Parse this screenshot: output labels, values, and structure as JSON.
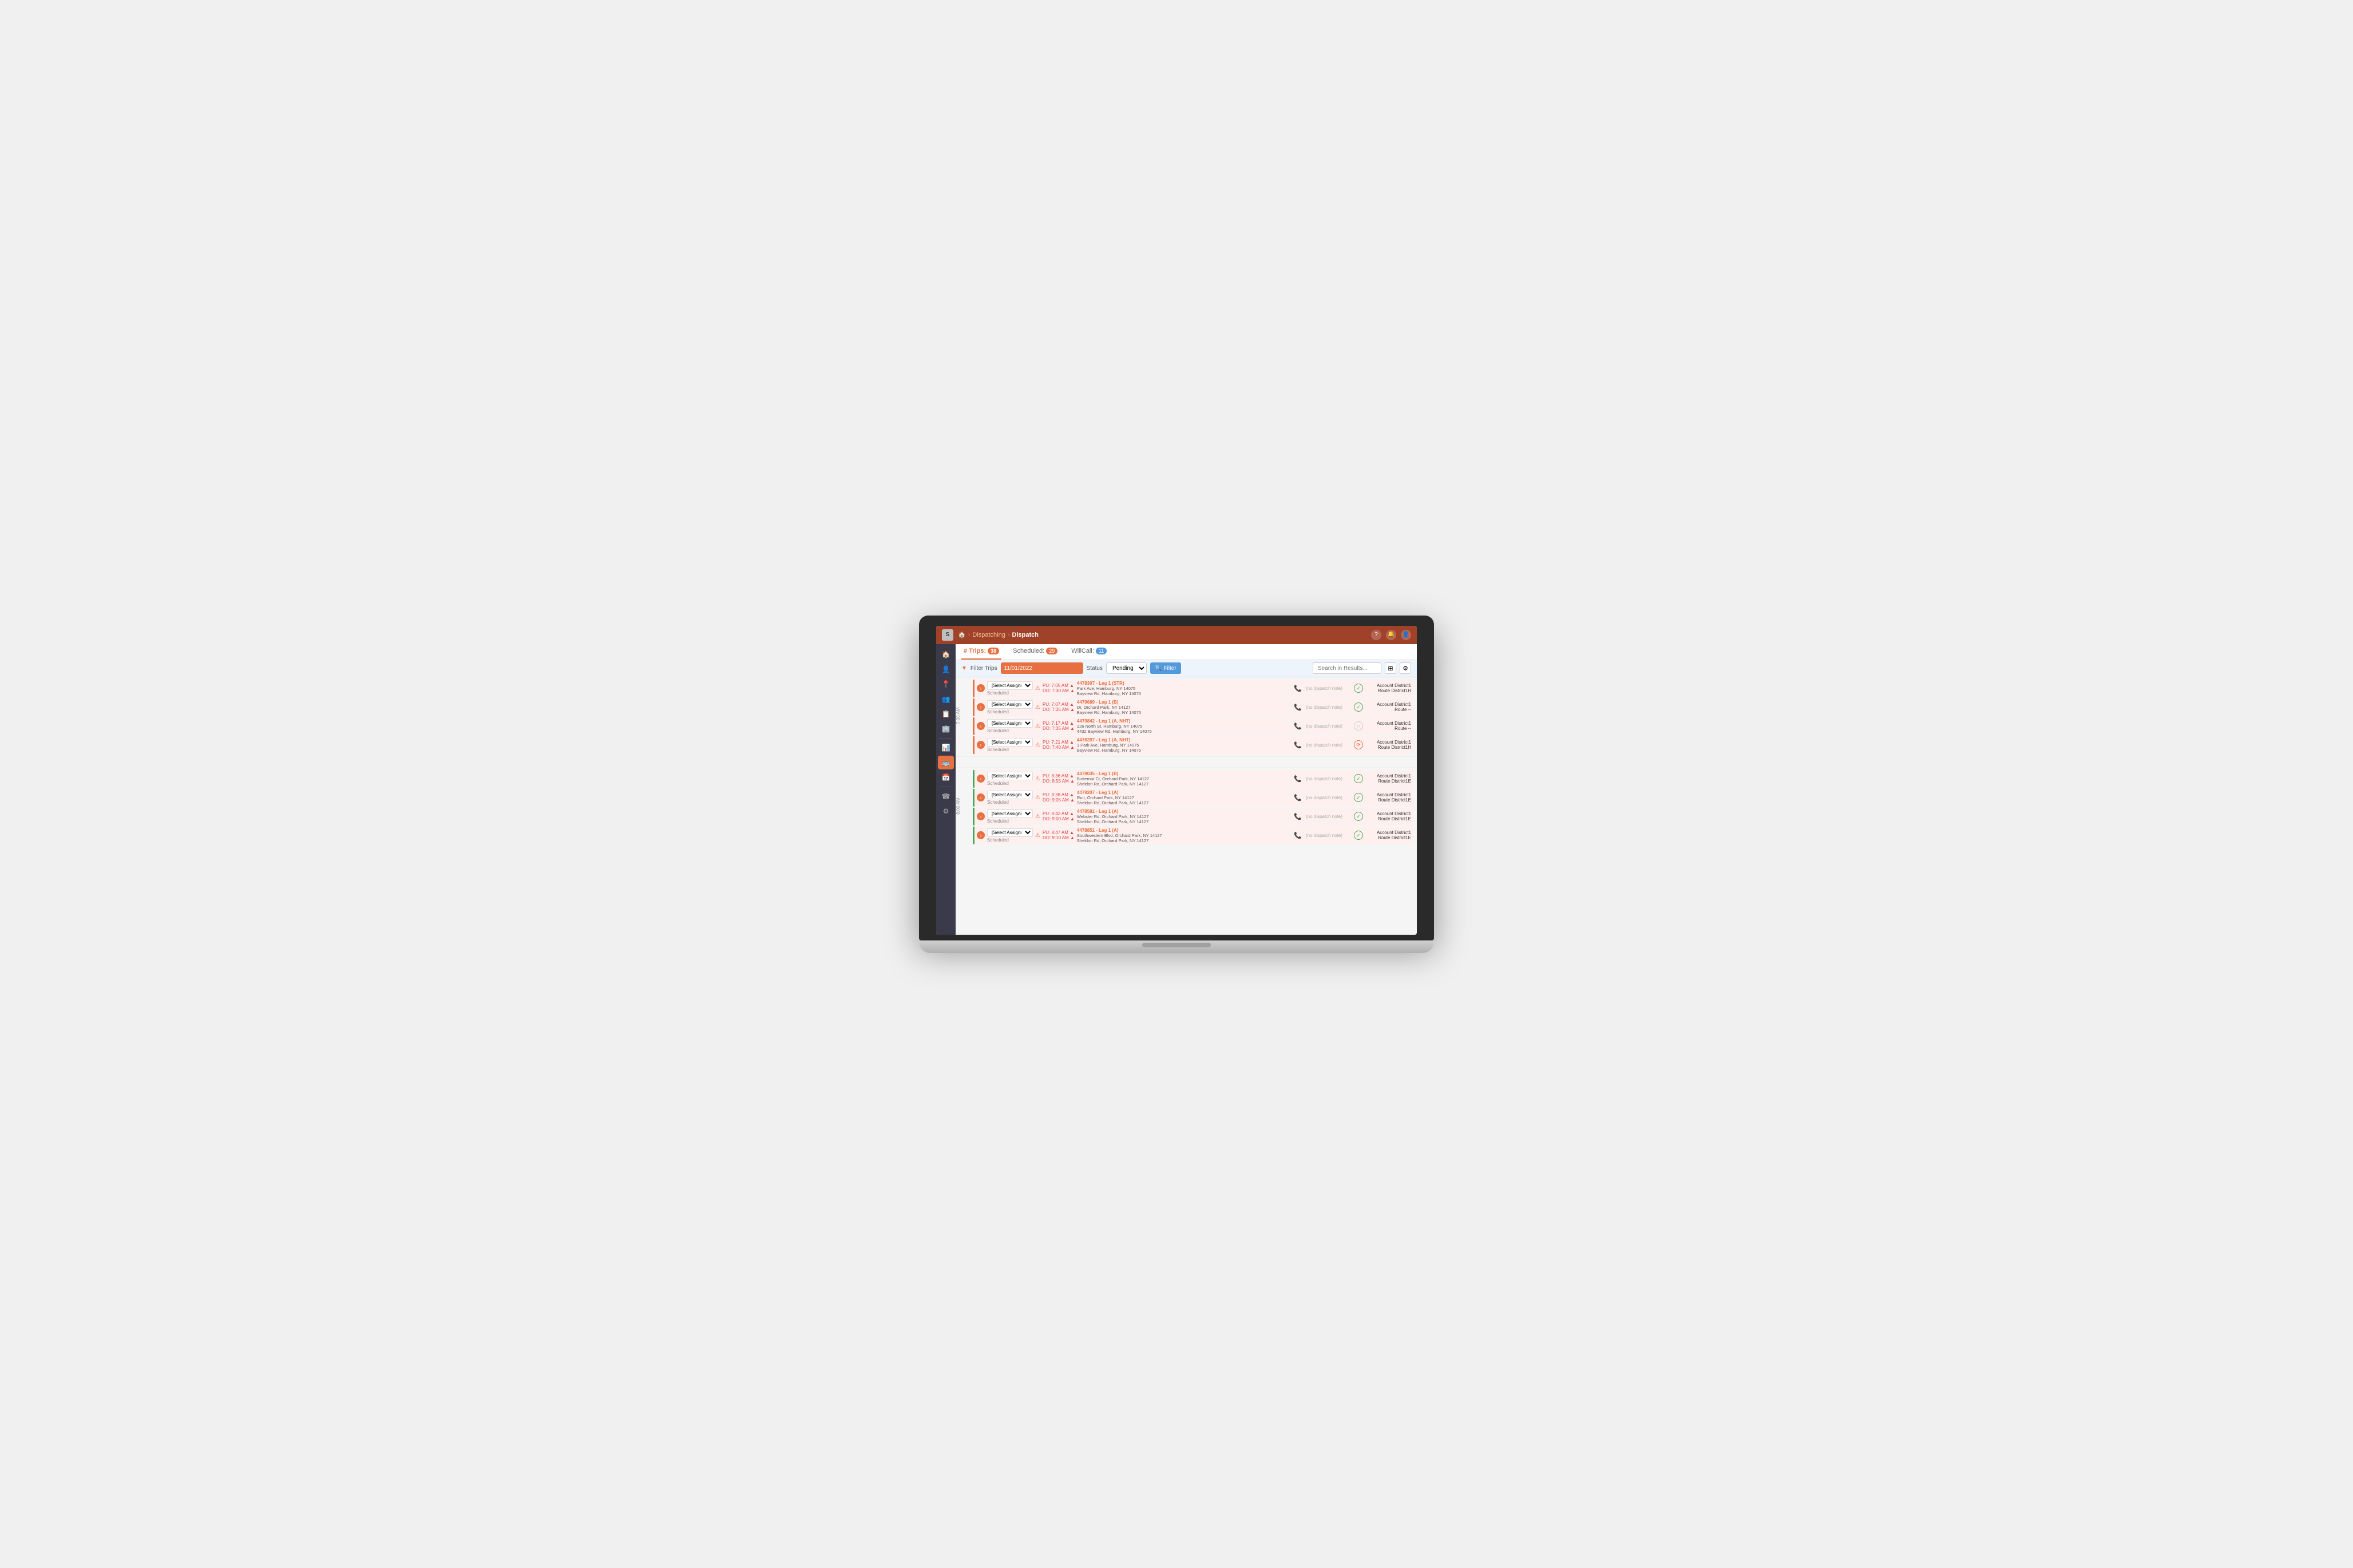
{
  "header": {
    "logo_text": "S",
    "breadcrumb": [
      "Home",
      "Dispatching",
      "Dispatch"
    ],
    "icons": [
      "help",
      "bell",
      "user"
    ]
  },
  "sidebar": {
    "items": [
      {
        "icon": "🏠",
        "name": "home",
        "active": false
      },
      {
        "icon": "👤",
        "name": "people",
        "active": false
      },
      {
        "icon": "📍",
        "name": "location",
        "active": false
      },
      {
        "icon": "👥",
        "name": "users",
        "active": false
      },
      {
        "icon": "📋",
        "name": "clipboard",
        "active": false
      },
      {
        "icon": "🏢",
        "name": "building",
        "active": false
      },
      {
        "icon": "📊",
        "name": "reports",
        "active": false
      },
      {
        "icon": "🚌",
        "name": "bus",
        "active": true
      },
      {
        "icon": "📅",
        "name": "calendar",
        "active": false
      },
      {
        "icon": "☎",
        "name": "phone",
        "active": false
      },
      {
        "icon": "⚙",
        "name": "settings",
        "active": false
      }
    ]
  },
  "tabs": {
    "items": [
      {
        "label": "# Trips:",
        "badge": "38",
        "badge_color": "orange"
      },
      {
        "label": "Scheduled:",
        "badge": "29",
        "badge_color": "orange"
      },
      {
        "label": "WillCall:",
        "badge": "11",
        "badge_color": "blue"
      }
    ]
  },
  "filter_bar": {
    "label": "Filter Trips",
    "date": "11/01/2022",
    "status_label": "Status",
    "status_value": "Pending",
    "filter_btn": "Filter",
    "search_placeholder": "Search in Results...",
    "columns_icon": "⊞",
    "settings_icon": "⚙"
  },
  "trips_7am": {
    "time_label": "7:00 AM",
    "rows": [
      {
        "id": "trip-1",
        "assign": "[Select Assignment]",
        "status": "Scheduled",
        "pu_time": "7:05 AM",
        "do_time": "7:30 AM",
        "trip_id": "4478307 - Leg 1 (STR)",
        "address1": "Park Ave, Hamburg, NY 14075",
        "address2": "Bayview Rd, Hamburg, NY 14075",
        "note": "(no dispatch note)",
        "account": "Account District1",
        "route": "Route District1H",
        "has_check": true,
        "check_state": "checked"
      },
      {
        "id": "trip-2",
        "assign": "[Select Assignment]",
        "status": "Scheduled",
        "pu_time": "7:07 AM",
        "do_time": "7:35 AM",
        "trip_id": "4479689 - Leg 1 (B)",
        "address1": "Dr, Orchard Park, NY 14127",
        "address2": "Bayview Rd, Hamburg, NY 14075",
        "note": "(no dispatch note)",
        "account": "Account District1",
        "route": "Route --",
        "has_check": true,
        "check_state": "checked"
      },
      {
        "id": "trip-3",
        "assign": "[Select Assignment]",
        "status": "Scheduled",
        "pu_time": "7:17 AM",
        "do_time": "7:35 AM",
        "trip_id": "4479842 - Leg 1 (A, NHT)",
        "address1": "126 North St, Hamburg, NY 14075",
        "address2": "4432 Bayview Rd, Hamburg, NY 14075",
        "note": "(no dispatch note)",
        "account": "Account District1",
        "route": "Route --",
        "has_check": true,
        "check_state": "unchecked"
      },
      {
        "id": "trip-4",
        "assign": "[Select Assignment]",
        "status": "Scheduled",
        "pu_time": "7:21 AM",
        "do_time": "7:40 AM",
        "trip_id": "4478287 - Leg 1 (A, NHT)",
        "address1": "1 Park Ave, Hamburg, NY 14075",
        "address2": "Bayview Rd, Hamburg, NY 14075",
        "note": "(no dispatch note)",
        "account": "Account District1",
        "route": "Route District1H",
        "has_check": true,
        "check_state": "orange_check"
      }
    ]
  },
  "trips_8am": {
    "time_label": "8:00 AM",
    "rows": [
      {
        "id": "trip-5",
        "assign": "[Select Assignment]",
        "status": "Scheduled",
        "pu_time": "8:36 AM",
        "do_time": "8:55 AM",
        "trip_id": "4478035 - Leg 1 (B)",
        "address1": "Butternut Ct, Orchard Park, NY 14127",
        "address2": "Sheldon Rd, Orchard Park, NY 14127",
        "note": "(no dispatch note)",
        "account": "Account District1",
        "route": "Route District1E",
        "has_check": true,
        "check_state": "checked"
      },
      {
        "id": "trip-6",
        "assign": "[Select Assignment]",
        "status": "Scheduled",
        "pu_time": "8:38 AM",
        "do_time": "9:05 AM",
        "trip_id": "4479207 - Leg 1 (A)",
        "address1": "Run, Orchard Park, NY 14127",
        "address2": "Sheldon Rd, Orchard Park, NY 14127",
        "note": "(no dispatch note)",
        "account": "Account District1",
        "route": "Route District1E",
        "has_check": true,
        "check_state": "checked"
      },
      {
        "id": "trip-7",
        "assign": "[Select Assignment]",
        "status": "Scheduled",
        "pu_time": "8:42 AM",
        "do_time": "9:00 AM",
        "trip_id": "4478581 - Leg 1 (A)",
        "address1": "Webster Rd, Orchard Park, NY 14127",
        "address2": "Sheldon Rd, Orchard Park, NY 14127",
        "note": "(no dispatch note)",
        "account": "Account District1",
        "route": "Route District1E",
        "has_check": true,
        "check_state": "checked"
      },
      {
        "id": "trip-8",
        "assign": "[Select Assignment]",
        "status": "Scheduled",
        "pu_time": "8:47 AM",
        "do_time": "9:10 AM",
        "trip_id": "4478851 - Leg 1 (A)",
        "address1": "Southwestern Blvd, Orchard Park, NY 14127",
        "address2": "Sheldon Rd, Orchard Park, NY 14127",
        "note": "(no dispatch note)",
        "account": "Account District1",
        "route": "Route District1E",
        "has_check": true,
        "check_state": "checked"
      }
    ]
  }
}
